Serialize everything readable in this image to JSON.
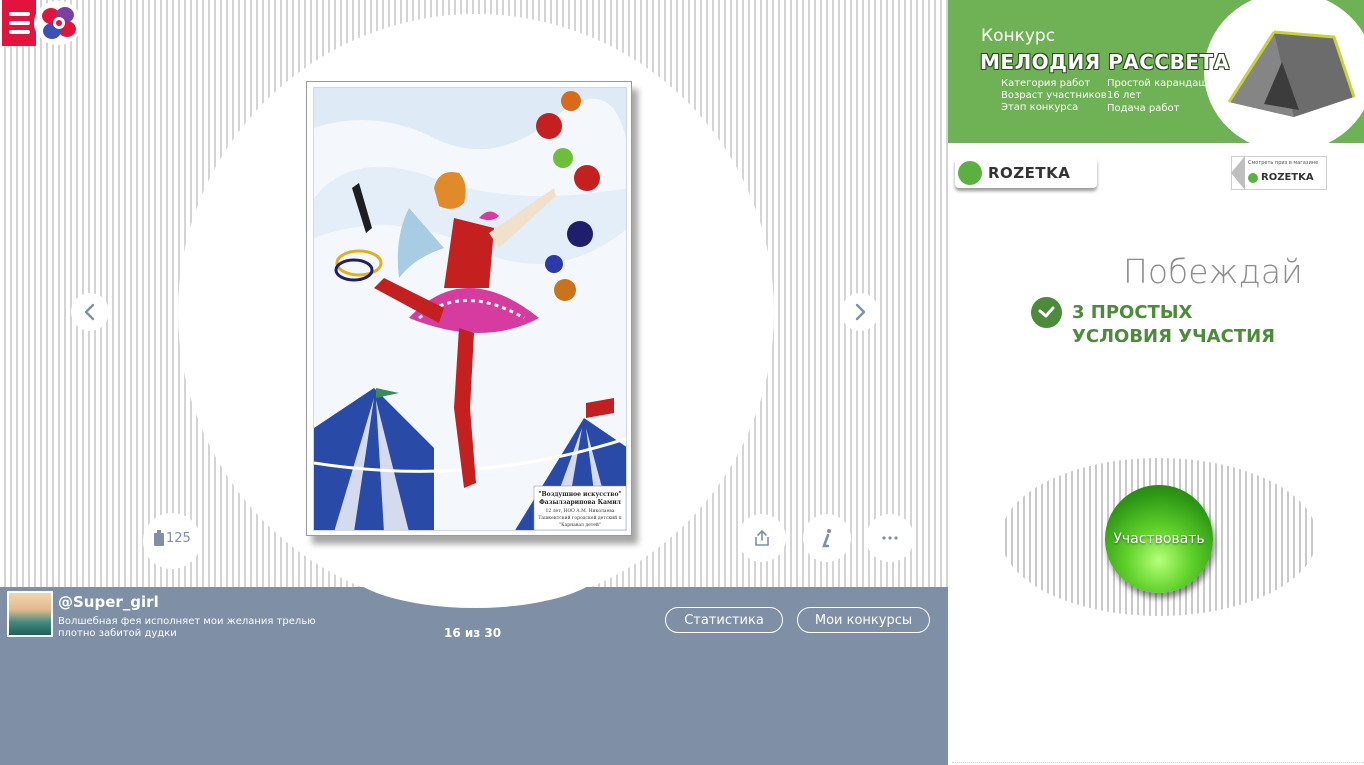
{
  "contest_banner": {
    "label": "Конкурс",
    "title": "МЕЛОДИЯ РАССВЕТА",
    "category_label": "Категория работ",
    "category_value": "Простой карандаш",
    "age_label": "Возраст участников",
    "age_value": "16 лет",
    "stage_label": "Этап конкурса",
    "stage_value": "Подача работ"
  },
  "sponsor": {
    "name": "ROZETKA",
    "shop_note": "Смотреть приз в магазине",
    "shop_name": "ROZETKA"
  },
  "promo": {
    "headline": "Побеждай",
    "conditions": "3 ПРОСТЫХ УСЛОВИЯ УЧАСТИЯ",
    "participate_label": "Участвовать"
  },
  "viewer": {
    "likes": "125",
    "counter": "16 из 30"
  },
  "author": {
    "username": "@Super_girl",
    "caption": "Волшебная фея исполняет мои желания трелью плотно забитой дудки"
  },
  "artwork_label": {
    "title": "\"Воздушное искусство\"",
    "author": "Фазылзарипова Камил",
    "line1": "12 лет, НОО А.М. Николаева",
    "line2": "Ташкентский городской детский п",
    "line3": "\"Карнавал детей\""
  },
  "actions": {
    "statistics": "Статистика",
    "my_contests": "Мои конкурсы"
  },
  "colors": {
    "brand_red": "#e0143c",
    "panel_slate": "#7f8fa5",
    "green": "#6fb155",
    "dark_green": "#4b8b3a"
  }
}
